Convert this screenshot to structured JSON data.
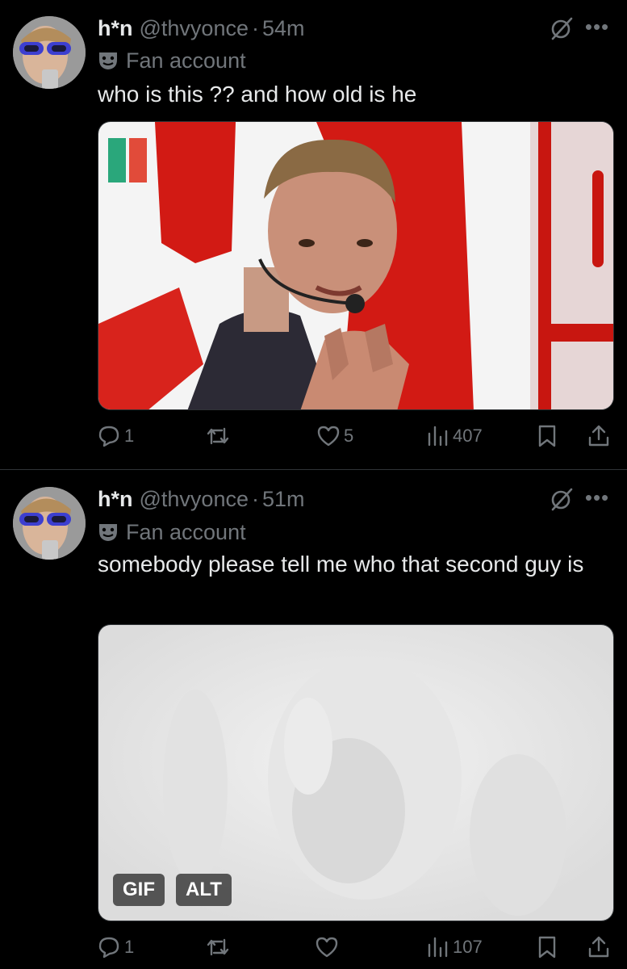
{
  "tweets": [
    {
      "name": "h*n",
      "handle": "@thvyonce",
      "separator": "·",
      "time": "54m",
      "label": "Fan account",
      "text": "who is this ?? and how old is he",
      "media": {
        "type": "image",
        "badges": []
      },
      "stats": {
        "replies": "1",
        "retweets": "",
        "likes": "5",
        "views": "407"
      }
    },
    {
      "name": "h*n",
      "handle": "@thvyonce",
      "separator": "·",
      "time": "51m",
      "label": "Fan account",
      "text": "somebody please tell me who that second guy is",
      "media": {
        "type": "gif",
        "badges": [
          "GIF",
          "ALT"
        ]
      },
      "stats": {
        "replies": "1",
        "retweets": "",
        "likes": "",
        "views": "107"
      }
    }
  ],
  "colors": {
    "background": "#000000",
    "text_primary": "#e7e9ea",
    "text_secondary": "#71767b",
    "divider": "#2f3336"
  },
  "icons": [
    "grok-icon",
    "more-icon",
    "fan-account-mask-icon",
    "reply-icon",
    "retweet-icon",
    "like-icon",
    "views-icon",
    "bookmark-icon",
    "share-icon"
  ]
}
